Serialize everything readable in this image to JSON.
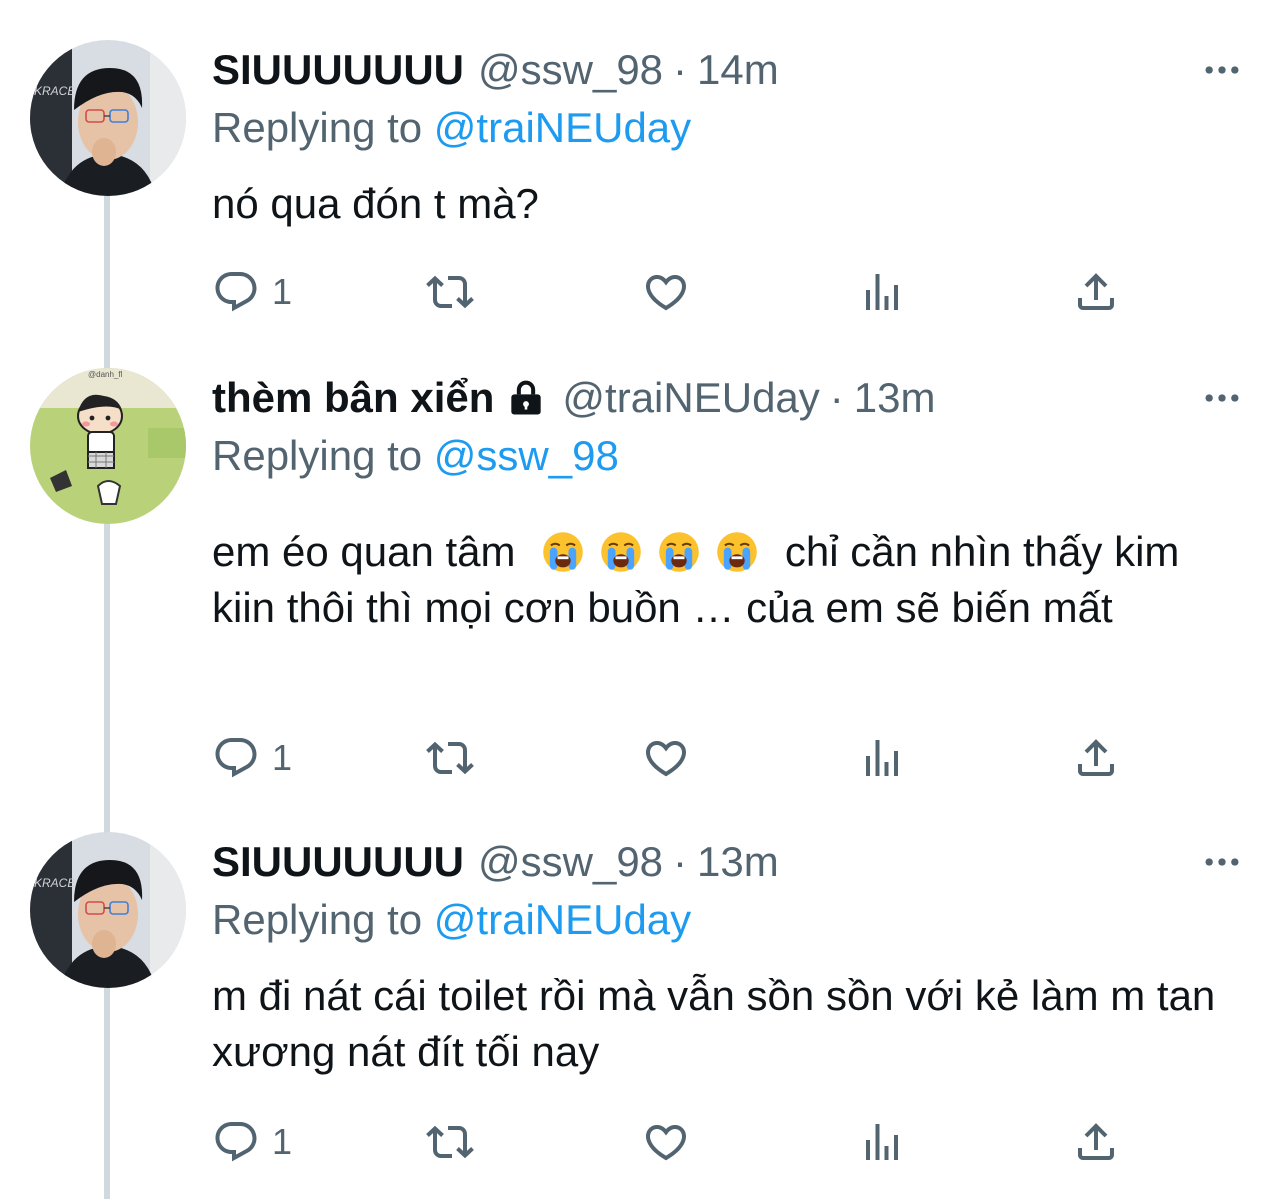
{
  "tweets": [
    {
      "display_name": "SIUUUUUUU",
      "handle": "@ssw_98",
      "separator": "·",
      "time": "14m",
      "replying_prefix": "Replying to",
      "replying_to": "@traiNEUday",
      "text": "nó qua đón t mà?",
      "reply_count": "1"
    },
    {
      "display_name": "thèm bân xiển",
      "handle": "@traiNEUday",
      "separator": "·",
      "time": "13m",
      "replying_prefix": "Replying to",
      "replying_to": "@ssw_98",
      "text_prefix": "em éo quan tâm",
      "text_suffix": "chỉ cần nhìn thấy kim kiin thôi thì mọi cơn buồn … của em sẽ biến mất",
      "reply_count": "1",
      "avatar_caption": "@danh_fl"
    },
    {
      "display_name": "SIUUUUUUU",
      "handle": "@ssw_98",
      "separator": "·",
      "time": "13m",
      "replying_prefix": "Replying to",
      "replying_to": "@traiNEUday",
      "text": "m đi nát cái toilet rồi mà vẫn sồn sồn với kẻ làm m tan xương nát đít tối nay",
      "reply_count": "1"
    }
  ],
  "icons": {
    "reply": "speech-bubble-icon",
    "retweet": "retweet-icon",
    "like": "heart-icon",
    "views": "bar-chart-icon",
    "share": "share-icon",
    "more": "more-dots-icon",
    "lock": "lock-icon",
    "emoji": "loudly-crying-face-emoji"
  },
  "colors": {
    "text": "#0f1419",
    "secondary": "#536471",
    "link": "#1d9bf0",
    "thread_line": "#cfd9de"
  }
}
